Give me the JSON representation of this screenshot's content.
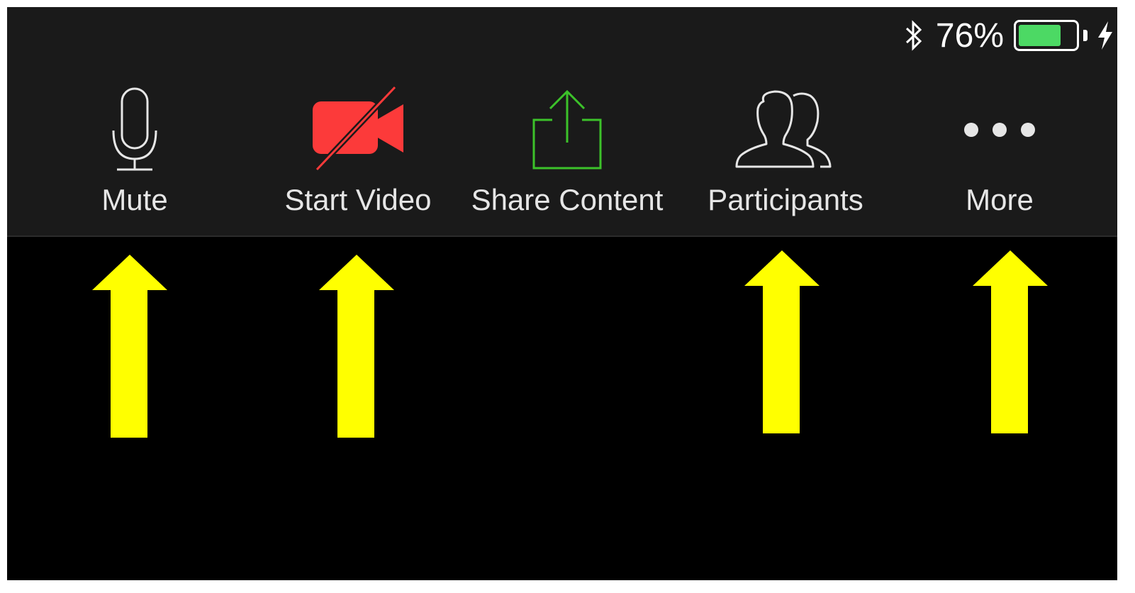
{
  "status_bar": {
    "battery_percent_text": "76%",
    "battery_level": 0.76,
    "battery_color": "#4cd964",
    "bluetooth_icon": "bluetooth-icon",
    "charging_icon": "lightning-bolt-icon"
  },
  "toolbar": {
    "buttons": [
      {
        "label": "Mute",
        "icon": "microphone-icon"
      },
      {
        "label": "Start Video",
        "icon": "video-camera-off-icon",
        "color": "#fc3a3a"
      },
      {
        "label": "Share Content",
        "icon": "share-upload-icon",
        "color": "#3cc22a"
      },
      {
        "label": "Participants",
        "icon": "participants-icon"
      },
      {
        "label": "More",
        "icon": "more-dots-icon"
      }
    ]
  },
  "annotations": {
    "arrow_color": "#ffff00"
  }
}
